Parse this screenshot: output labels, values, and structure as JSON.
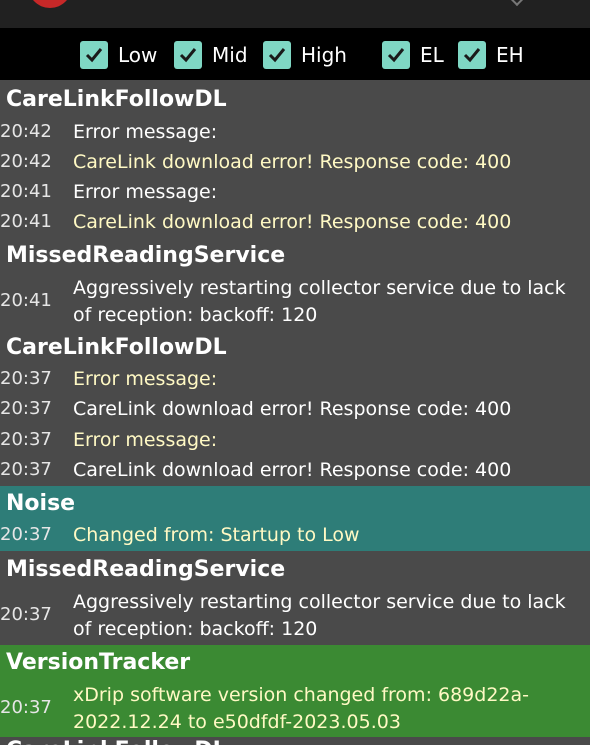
{
  "filters": [
    {
      "label": "Low",
      "checked": true
    },
    {
      "label": "Mid",
      "checked": true
    },
    {
      "label": "High",
      "checked": true
    },
    {
      "label": "EL",
      "checked": true
    },
    {
      "label": "EH",
      "checked": true
    }
  ],
  "colors": {
    "checkbox": "#7fd7c4",
    "log_background": "#4a4a4a",
    "noise_background": "#2e7d78",
    "version_background": "#3b8a33",
    "highlight_text": "#fff9c4"
  },
  "log": {
    "sections": [
      {
        "title": "CareLinkFollowDL",
        "entries": [
          {
            "time": "20:42",
            "message": "Error message:"
          },
          {
            "time": "20:42",
            "message": "CareLink download error! Response code: 400"
          },
          {
            "time": "20:41",
            "message": "Error message:"
          },
          {
            "time": "20:41",
            "message": "CareLink download error! Response code: 400"
          }
        ]
      },
      {
        "title": "MissedReadingService",
        "entries": [
          {
            "time": "20:41",
            "message": "Aggressively restarting collector service due to lack of reception: backoff: 120"
          }
        ]
      },
      {
        "title": "CareLinkFollowDL",
        "entries": [
          {
            "time": "20:37",
            "message": "Error message:"
          },
          {
            "time": "20:37",
            "message": "CareLink download error! Response code: 400"
          },
          {
            "time": "20:37",
            "message": "Error message:"
          },
          {
            "time": "20:37",
            "message": "CareLink download error! Response code: 400"
          }
        ]
      },
      {
        "title": "Noise",
        "entries": [
          {
            "time": "20:37",
            "message": "Changed from: Startup to Low"
          }
        ]
      },
      {
        "title": "MissedReadingService",
        "entries": [
          {
            "time": "20:37",
            "message": "Aggressively restarting collector service due to lack of reception: backoff: 120"
          }
        ]
      },
      {
        "title": "VersionTracker",
        "entries": [
          {
            "time": "20:37",
            "message": "xDrip software version changed from: 689d22a-2022.12.24 to e50dfdf-2023.05.03"
          }
        ]
      },
      {
        "title": "CareLinkFollowDL",
        "entries": []
      }
    ]
  }
}
